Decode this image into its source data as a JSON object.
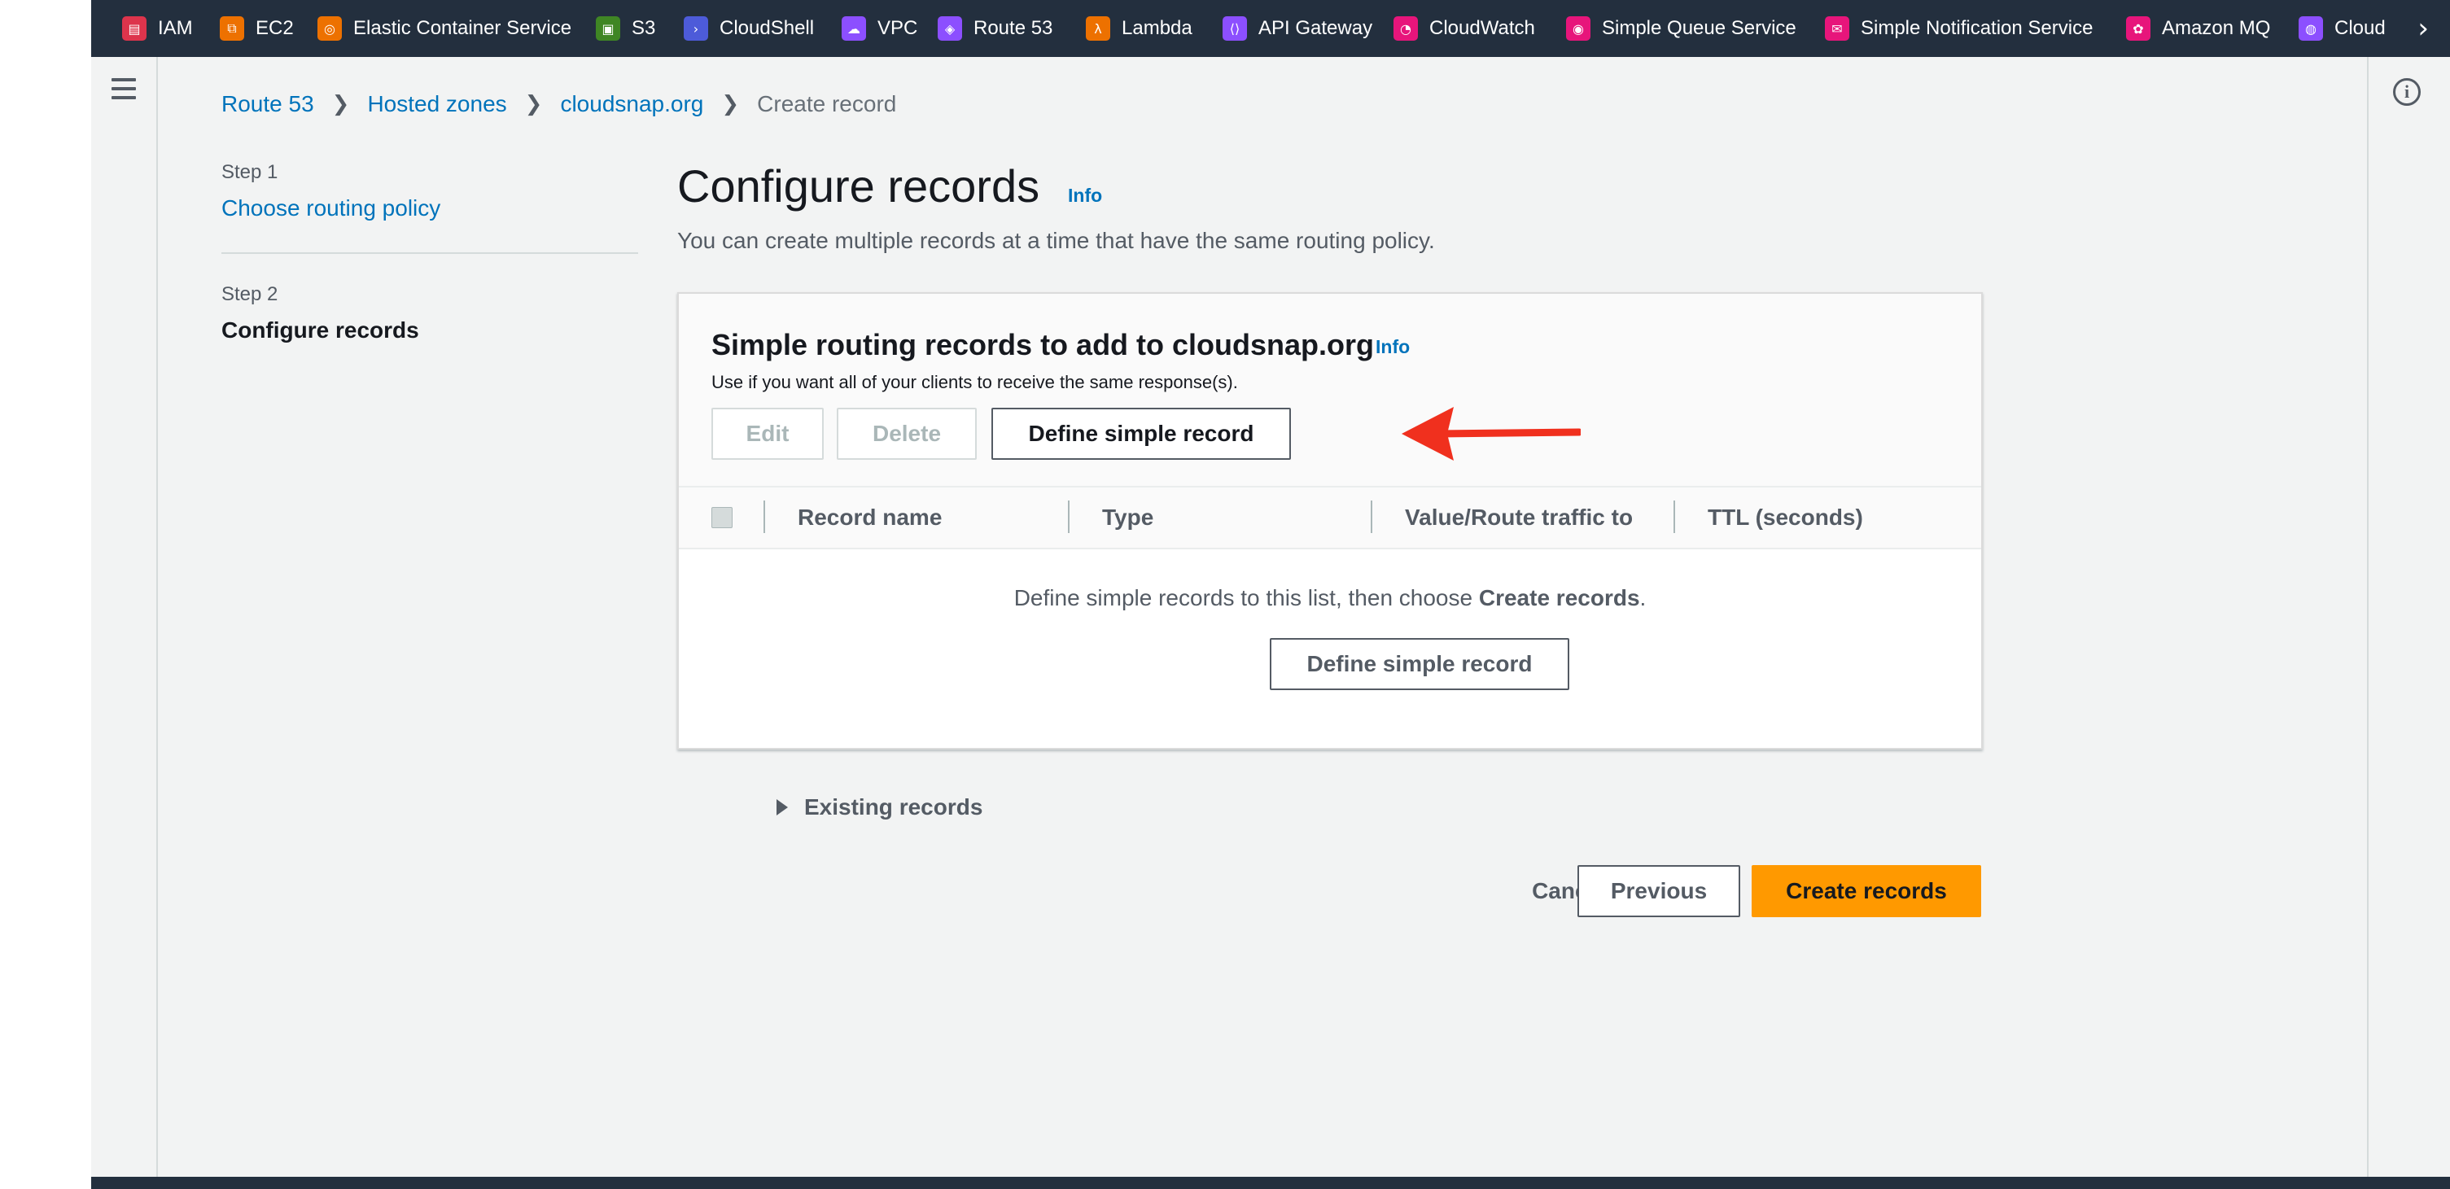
{
  "favorites": [
    {
      "label": "IAM",
      "icon": "iam-icon",
      "color": "#dd344c",
      "glyph": "▤"
    },
    {
      "label": "EC2",
      "icon": "ec2-icon",
      "color": "#ed7100",
      "glyph": "⧉"
    },
    {
      "label": "Elastic Container Service",
      "icon": "ecs-icon",
      "color": "#ed7100",
      "glyph": "◎"
    },
    {
      "label": "S3",
      "icon": "s3-icon",
      "color": "#3f8624",
      "glyph": "▣"
    },
    {
      "label": "CloudShell",
      "icon": "cloudshell-icon",
      "color": "#4d5bd9",
      "glyph": "›"
    },
    {
      "label": "VPC",
      "icon": "vpc-icon",
      "color": "#8c4fff",
      "glyph": "☁"
    },
    {
      "label": "Route 53",
      "icon": "route53-icon",
      "color": "#8c4fff",
      "glyph": "◈"
    },
    {
      "label": "Lambda",
      "icon": "lambda-icon",
      "color": "#ed7100",
      "glyph": "λ"
    },
    {
      "label": "API Gateway",
      "icon": "api-gateway-icon",
      "color": "#8c4fff",
      "glyph": "⟨⟩"
    },
    {
      "label": "CloudWatch",
      "icon": "cloudwatch-icon",
      "color": "#e7157b",
      "glyph": "◔"
    },
    {
      "label": "Simple Queue Service",
      "icon": "sqs-icon",
      "color": "#e7157b",
      "glyph": "◉"
    },
    {
      "label": "Simple Notification Service",
      "icon": "sns-icon",
      "color": "#e7157b",
      "glyph": "✉"
    },
    {
      "label": "Amazon MQ",
      "icon": "amazon-mq-icon",
      "color": "#e7157b",
      "glyph": "✿"
    },
    {
      "label": "Cloud",
      "icon": "cloud-service-icon",
      "color": "#8c4fff",
      "glyph": "◍"
    }
  ],
  "breadcrumb": {
    "items": [
      "Route 53",
      "Hosted zones",
      "cloudsnap.org"
    ],
    "current": "Create record"
  },
  "steps": {
    "step1_label": "Step 1",
    "step1_title": "Choose routing policy",
    "step2_label": "Step 2",
    "step2_title": "Configure records"
  },
  "page": {
    "title": "Configure records",
    "info": "Info",
    "description": "You can create multiple records at a time that have the same routing policy."
  },
  "container": {
    "title": "Simple routing records to add to cloudsnap.org",
    "info": "Info",
    "description": "Use if you want all of your clients to receive the same response(s).",
    "edit_label": "Edit",
    "delete_label": "Delete",
    "define_label": "Define simple record",
    "columns": [
      "Record name",
      "Type",
      "Value/Route traffic to",
      "TTL (seconds)"
    ],
    "empty_prefix": "Define simple records to this list, then choose ",
    "empty_bold": "Create records",
    "empty_suffix": ".",
    "empty_button": "Define simple record"
  },
  "existing_records_label": "Existing records",
  "footer": {
    "cancel": "Cancel",
    "previous": "Previous",
    "create": "Create records"
  },
  "colors": {
    "link": "#0073bb",
    "primary_button": "#ff9900",
    "navbar": "#232f3e",
    "annotation_arrow": "#f0301e"
  }
}
